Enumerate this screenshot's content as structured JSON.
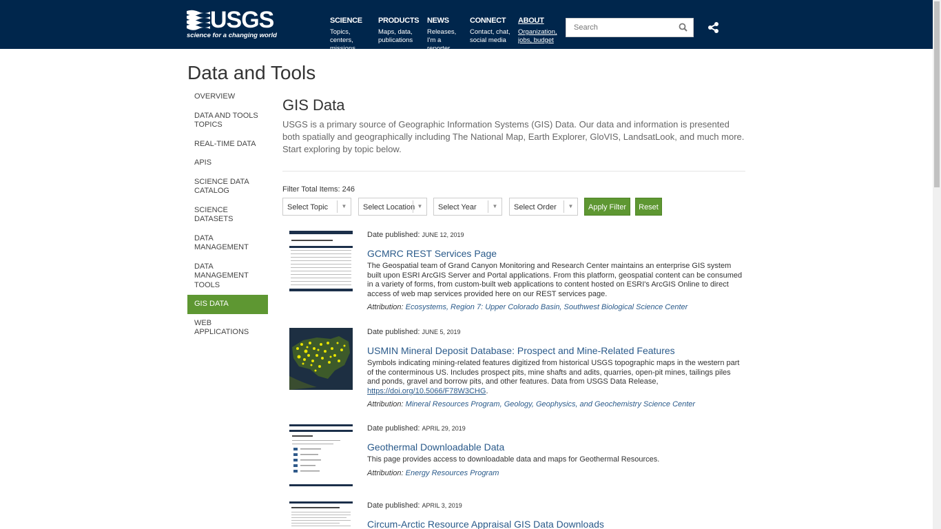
{
  "header": {
    "logo_text": "USGS",
    "logo_tagline": "science for a changing world",
    "nav": [
      {
        "title": "SCIENCE",
        "sub": "Topics, centers, missions"
      },
      {
        "title": "PRODUCTS",
        "sub": "Maps, data, publications"
      },
      {
        "title": "NEWS",
        "sub": "Releases, I'm a reporter"
      },
      {
        "title": "CONNECT",
        "sub": "Contact, chat, social media"
      },
      {
        "title": "ABOUT",
        "sub": "Organization, jobs, budget"
      }
    ],
    "search_placeholder": "Search",
    "colors": {
      "bg": "#00264c",
      "accent_green": "#5e9732"
    }
  },
  "page": {
    "title": "Data and Tools"
  },
  "sidebar": {
    "items": [
      {
        "label": "OVERVIEW"
      },
      {
        "label": "DATA AND TOOLS TOPICS"
      },
      {
        "label": "REAL-TIME DATA"
      },
      {
        "label": "APIS"
      },
      {
        "label": "SCIENCE DATA CATALOG"
      },
      {
        "label": "SCIENCE DATASETS"
      },
      {
        "label": "DATA MANAGEMENT"
      },
      {
        "label": "DATA MANAGEMENT TOOLS"
      },
      {
        "label": "GIS DATA",
        "active": true
      },
      {
        "label": "WEB APPLICATIONS"
      }
    ]
  },
  "main": {
    "heading": "GIS Data",
    "intro": "USGS is a primary source of Geographic Information Systems (GIS) Data. Our data and information is presented both spatially and geographically including The National Map, Earth Explorer, GloVIS, LandsatLook, and much more. Start exploring by topic below.",
    "filter": {
      "total_label": "Filter Total Items: 246",
      "selects": [
        "Select Topic",
        "Select Location",
        "Select Year",
        "Select Order"
      ],
      "apply": "Apply Filter",
      "reset": "Reset"
    },
    "items": [
      {
        "date_label": "Date published:",
        "date": "JUNE 12, 2019",
        "title": "GCMRC REST Services Page",
        "desc": "The Geospatial team of Grand Canyon Monitoring and Research Center maintains an enterprise GIS system built upon ESRI ArcGIS Server and Portal applications.  From this platform, geospatial content can be consumed in a variety of forms, from custom-built web applications to content hosted on ESRI's ArcGIS Online to direct access of web map services provided here on our REST services page.",
        "attr_label": "Attribution:",
        "attr": "Ecosystems, Region 7: Upper Colorado Basin, Southwest Biological Science Center",
        "thumb": "table-screenshot"
      },
      {
        "date_label": "Date published:",
        "date": "JUNE 5, 2019",
        "title": "USMIN Mineral Deposit Database: Prospect and Mine-Related Features",
        "desc": "Symbols indicating mining-related features digitized from historical USGS topographic maps in the western part of the conterminous US. Includes prospect pits, mine shafts and adits, quarries, open-pit mines, tailings piles and ponds, gravel and borrow pits, and other features. Data from USGS Data Release,",
        "link": "https://doi.org/10.5066/F78W3CHG",
        "attr_label": "Attribution:",
        "attr": "Mineral Resources Program, Geology, Geophysics, and Geochemistry Science Center",
        "thumb": "us-map"
      },
      {
        "date_label": "Date published:",
        "date": "APRIL 29, 2019",
        "title": "Geothermal Downloadable Data",
        "desc": "This page provides access to downloadable data and maps for Geothermal Resources.",
        "attr_label": "Attribution:",
        "attr": "Energy Resources Program",
        "thumb": "page-screenshot"
      },
      {
        "date_label": "Date published:",
        "date": "APRIL 3, 2019",
        "title": "Circum-Arctic Resource Appraisal GIS Data Downloads",
        "thumb": "doc-screenshot"
      }
    ]
  }
}
